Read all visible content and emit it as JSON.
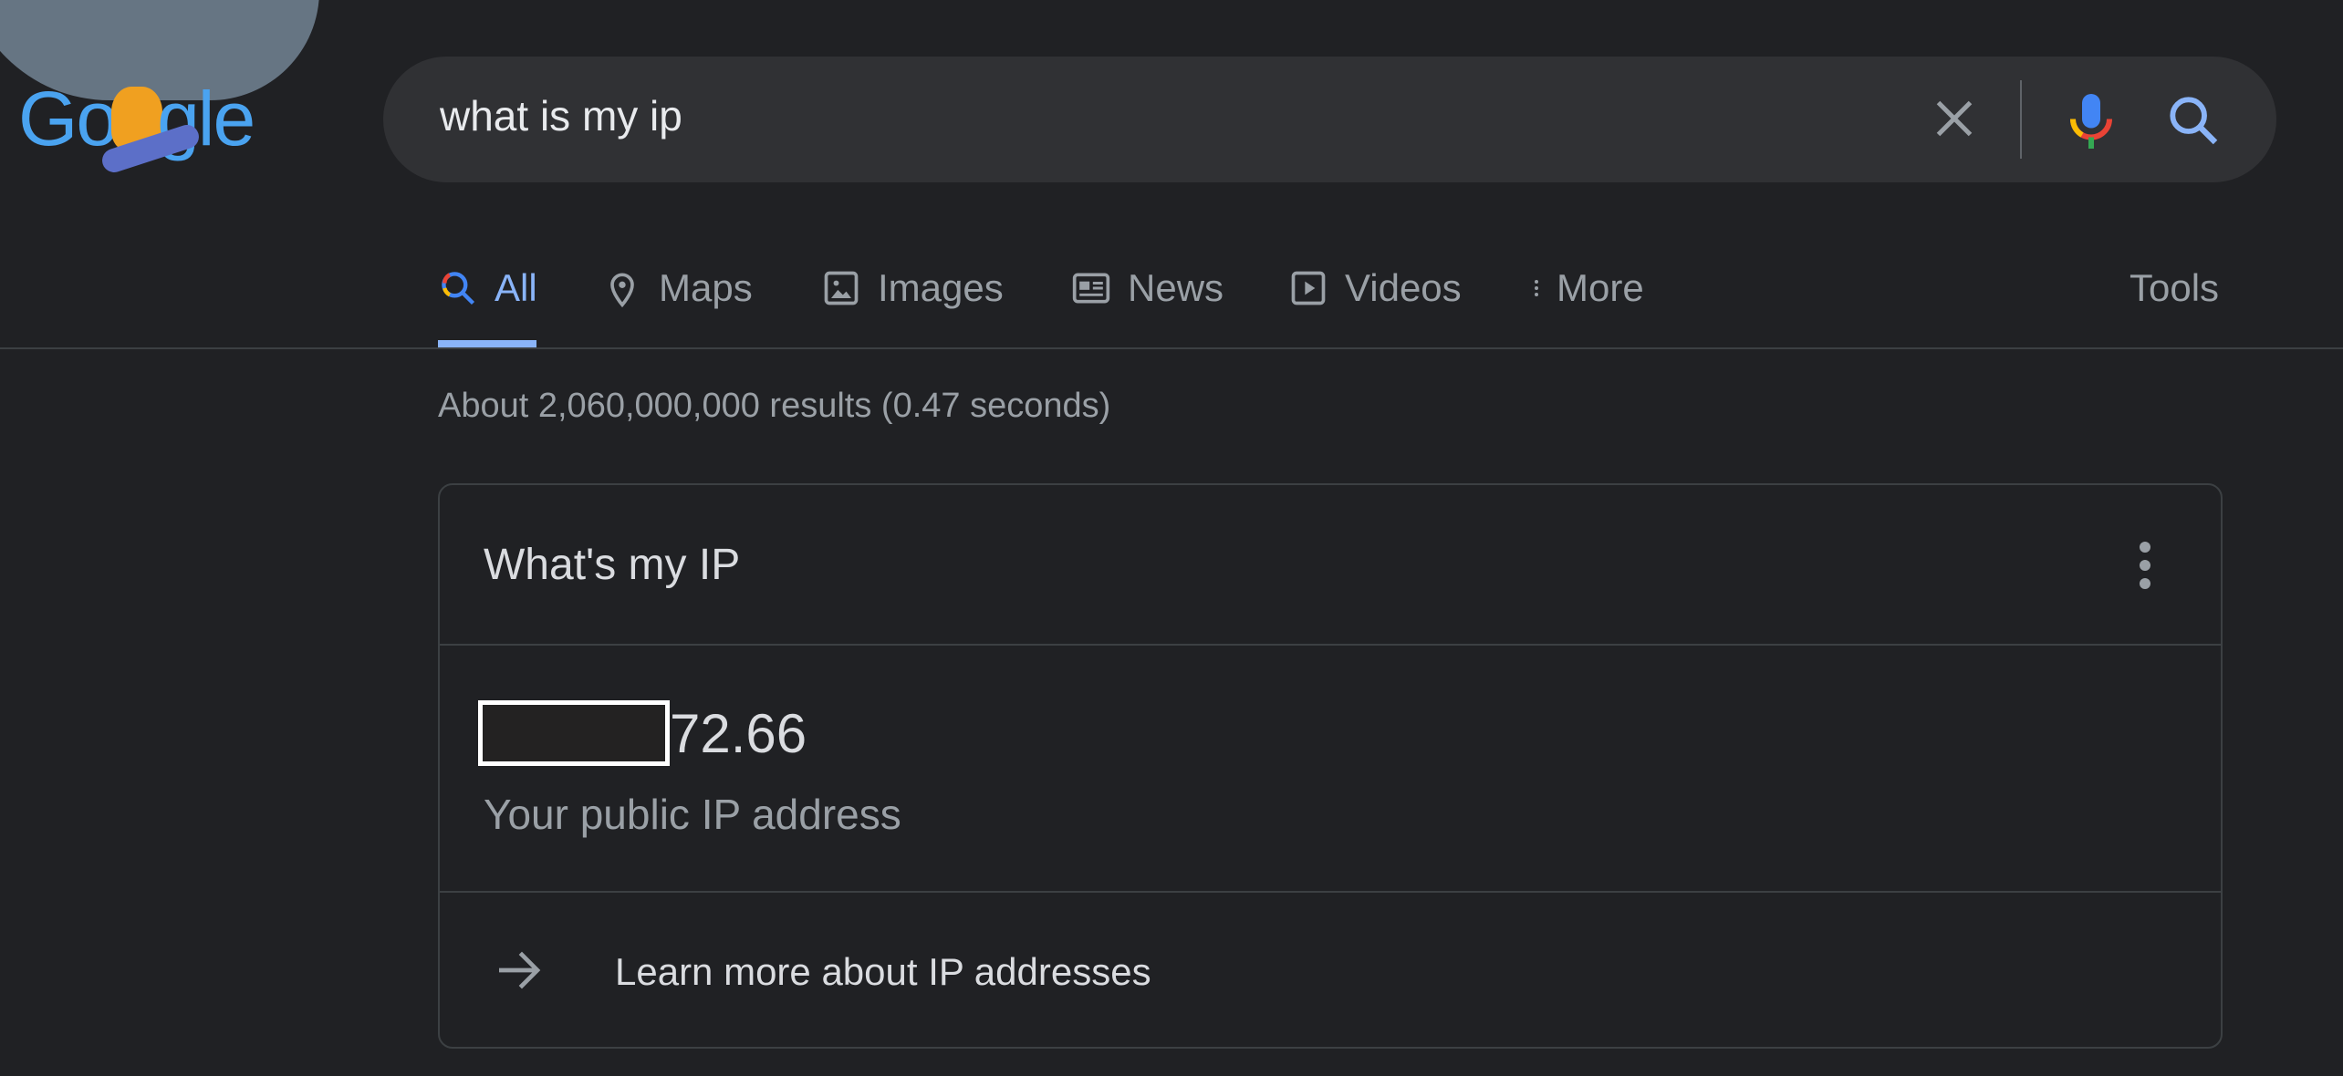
{
  "logo": {
    "text": "Google",
    "type": "doodle"
  },
  "search": {
    "query": "what is my ip",
    "clear_icon": "close-icon",
    "mic_icon": "mic-icon",
    "search_icon": "search-icon"
  },
  "tabs": [
    {
      "label": "All",
      "icon": "search-icon",
      "active": true
    },
    {
      "label": "Maps",
      "icon": "map-pin-icon"
    },
    {
      "label": "Images",
      "icon": "image-icon"
    },
    {
      "label": "News",
      "icon": "news-icon"
    },
    {
      "label": "Videos",
      "icon": "play-icon"
    },
    {
      "label": "More",
      "icon": "more-vert-icon"
    }
  ],
  "tools_label": "Tools",
  "stats": "About 2,060,000,000 results (0.47 seconds)",
  "card": {
    "title": "What's my IP",
    "ip_visible_suffix": "72.66",
    "ip_label": "Your public IP address",
    "learn_more": "Learn more about IP addresses"
  },
  "colors": {
    "background": "#202124",
    "accent": "#8ab4f8"
  }
}
